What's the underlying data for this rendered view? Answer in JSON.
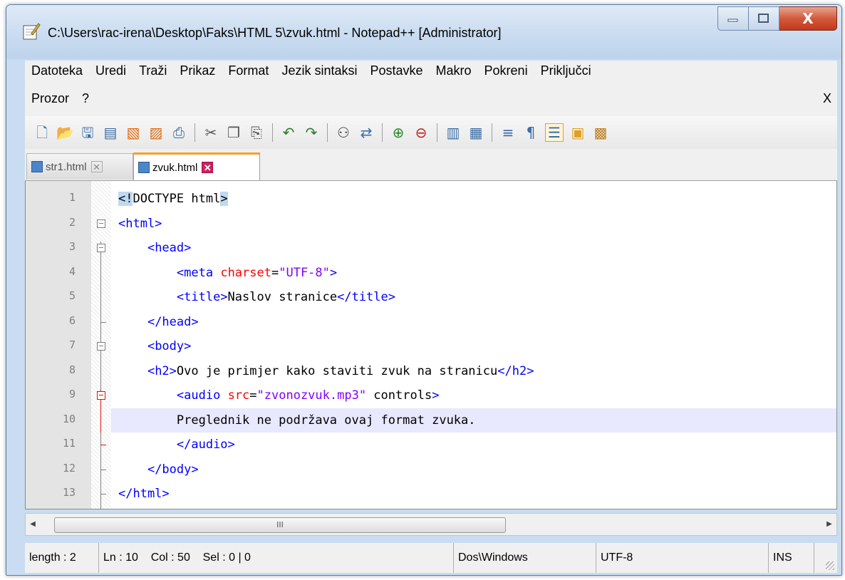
{
  "window": {
    "title": "C:\\Users\\rac-irena\\Desktop\\Faks\\HTML 5\\zvuk.html - Notepad++ [Administrator]",
    "minimize_label": "—",
    "maximize_label": "□",
    "close_label": "X"
  },
  "menu": {
    "row1": [
      "Datoteka",
      "Uredi",
      "Traži",
      "Prikaz",
      "Format",
      "Jezik sintaksi",
      "Postavke",
      "Makro",
      "Pokreni",
      "Priključci"
    ],
    "row2": [
      "Prozor",
      "?"
    ],
    "close": "X"
  },
  "toolbar": {
    "icons": [
      "new-file-icon",
      "open-file-icon",
      "save-icon",
      "save-all-icon",
      "close-icon",
      "close-all-icon",
      "print-icon",
      "cut-icon",
      "copy-icon",
      "paste-icon",
      "undo-icon",
      "redo-icon",
      "find-icon",
      "replace-icon",
      "zoom-in-icon",
      "zoom-out-icon",
      "sync-vertical-icon",
      "sync-horizontal-icon",
      "word-wrap-icon",
      "show-all-chars-icon",
      "indent-guide-icon",
      "user-defined-language-icon",
      "document-map-icon"
    ]
  },
  "tabs": [
    {
      "label": "str1.html",
      "active": false
    },
    {
      "label": "zvuk.html",
      "active": true
    }
  ],
  "editor": {
    "current_line": 10,
    "lines": [
      {
        "n": "1",
        "text": "<!DOCTYPE html>"
      },
      {
        "n": "2",
        "text": "<html>"
      },
      {
        "n": "3",
        "text": "    <head>"
      },
      {
        "n": "4",
        "text": "        <meta charset=\"UTF-8\">"
      },
      {
        "n": "5",
        "text": "        <title>Naslov stranice</title>"
      },
      {
        "n": "6",
        "text": "    </head>"
      },
      {
        "n": "7",
        "text": "    <body>"
      },
      {
        "n": "8",
        "text": "    <h2>Ovo je primjer kako staviti zvuk na stranicu</h2>"
      },
      {
        "n": "9",
        "text": "        <audio src=\"zvonozvuk.mp3\" controls>"
      },
      {
        "n": "10",
        "text": "        Preglednik ne podržava ovaj format zvuka."
      },
      {
        "n": "11",
        "text": "        </audio>"
      },
      {
        "n": "12",
        "text": "    </body>"
      },
      {
        "n": "13",
        "text": "</html>"
      }
    ]
  },
  "scrollbar": {
    "thumb_label": "III"
  },
  "status": {
    "length": "length : 2",
    "position": "Ln : 10    Col : 50    Sel : 0 | 0",
    "eol": "Dos\\Windows",
    "encoding": "UTF-8",
    "mode": "INS"
  },
  "colors": {
    "tag": "#0000ff",
    "attribute": "#ff0000",
    "string": "#8000ff",
    "current_line": "#e8e8ff",
    "tab_accent": "#f6a028"
  }
}
